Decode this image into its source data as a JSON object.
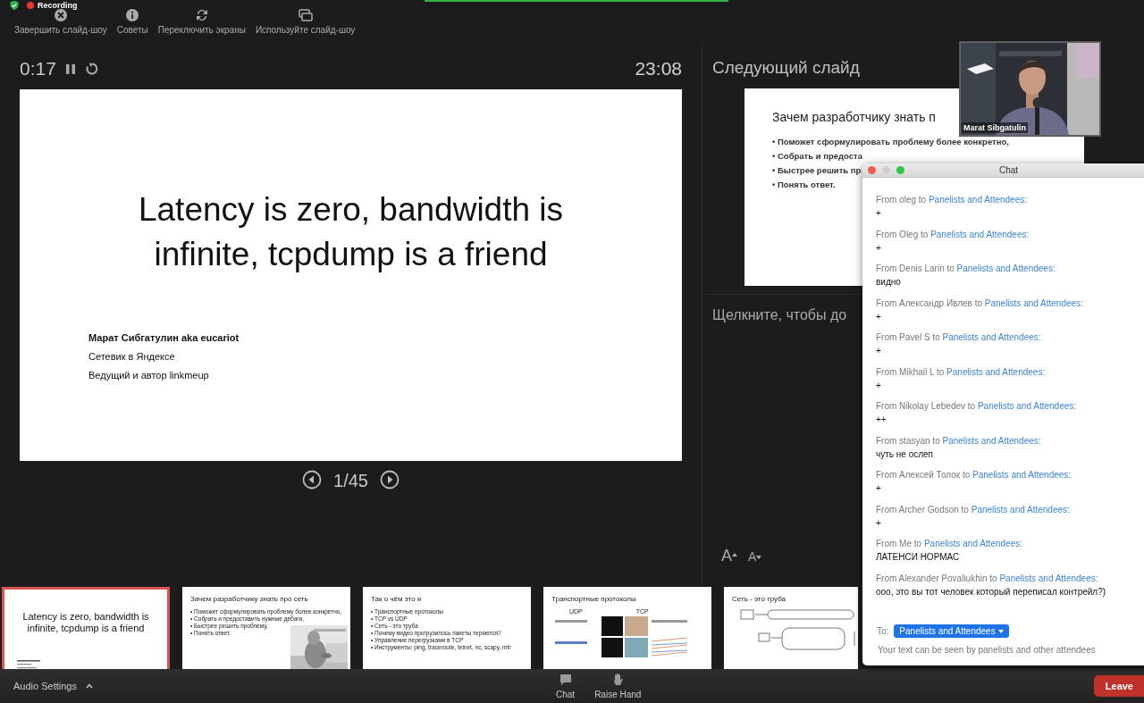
{
  "status": {
    "recording_label": "Recording"
  },
  "toolbar": [
    {
      "kind": "end",
      "label": "Завершить слайд-шоу"
    },
    {
      "kind": "tips",
      "label": "Советы"
    },
    {
      "kind": "swap",
      "label": "Переключить экраны"
    },
    {
      "kind": "display",
      "label": "Используйте слайд-шоу"
    }
  ],
  "presenter": {
    "elapsed": "0:17",
    "clock": "23:08",
    "slide_counter": "1/45",
    "current_slide": {
      "title": "Latency is zero, bandwidth is infinite, tcpdump is a friend",
      "author": "Марат Сибгатулин aka eucariot",
      "lines": [
        "Сетевик в Яндексе",
        "Ведущий и автор linkmeup"
      ]
    }
  },
  "next": {
    "heading": "Следующий слайд",
    "slide": {
      "title": "Зачем разработчику знать п",
      "bullets": [
        "• Поможет сформулировать проблему более конкретно,",
        "• Собрать и предоста",
        "• Быстрее решить пр",
        "• Понять ответ."
      ]
    },
    "notes_prompt": "Щелкните, чтобы до",
    "font_controls": [
      {
        "kind": "increase",
        "glyph": "A"
      },
      {
        "kind": "decrease",
        "glyph": "A"
      }
    ]
  },
  "thumbnails": [
    {
      "kind": "title",
      "selected": true,
      "title": "Latency is zero, bandwidth is infinite, tcpdump is a friend"
    },
    {
      "kind": "bullets",
      "selected": false,
      "title": "Зачем разработчику знать про сеть",
      "bullets": [
        "• Поможет сформулировать проблему более конкретно,",
        "• Собрать и предоставить нужные дебаги,",
        "• Быстрее решить проблему,",
        "• Понять ответ."
      ],
      "photo": true
    },
    {
      "kind": "bullets",
      "selected": false,
      "title": "Так о чём это я",
      "bullets": [
        "• Транспортные протоколы",
        "• TCP vs UDP",
        "• Сеть - это труба",
        "• Почему видео прогрузилось пакеты теряются?",
        "• Управление перегрузками в TCP",
        "• Инструменты: ping, traceroute, telnet, nc, scapy, mtr"
      ],
      "photo": false
    },
    {
      "kind": "protocols",
      "selected": false,
      "title": "Транспортные протоколы",
      "labels": [
        "UDP",
        "TCP"
      ]
    },
    {
      "kind": "pipe",
      "selected": false,
      "title": "Сеть - это труба"
    }
  ],
  "video": {
    "name": "Marat Sibgatulin"
  },
  "chat": {
    "title": "Chat",
    "messages": [
      {
        "from": "From oleg to",
        "recipient": "Panelists and Attendees:",
        "text": "+"
      },
      {
        "from": "From Oleg to",
        "recipient": "Panelists and Attendees:",
        "text": "+"
      },
      {
        "from": "From Denis Larin to",
        "recipient": "Panelists and Attendees:",
        "text": "видно"
      },
      {
        "from": "From Александр Ивлев to",
        "recipient": "Panelists and Attendees:",
        "text": "+"
      },
      {
        "from": "From Pavel S to",
        "recipient": "Panelists and Attendees:",
        "text": "+"
      },
      {
        "from": "From Mikhail L to",
        "recipient": "Panelists and Attendees:",
        "text": "+"
      },
      {
        "from": "From Nikolay Lebedev to",
        "recipient": "Panelists and Attendees:",
        "text": "++"
      },
      {
        "from": "From stasyan to",
        "recipient": "Panelists and Attendees:",
        "text": "чуть не ослеп"
      },
      {
        "from": "From Алексей Толок to",
        "recipient": "Panelists and Attendees:",
        "text": "+"
      },
      {
        "from": "From Archer Godson to",
        "recipient": "Panelists and Attendees:",
        "text": "+"
      },
      {
        "from": "From Me to",
        "recipient": "Panelists and Attendees:",
        "text": "ЛАТЕНСИ НОРМАС"
      },
      {
        "from": "From Alexander Povaliukhin to",
        "recipient": "Panelists and Attendees:",
        "text": "ооо, это вы тот человек который переписал контрейл?)"
      }
    ],
    "to_label": "To:",
    "recipient_choice": "Panelists and Attendees",
    "hint": "Your text can be seen by panelists and other attendees"
  },
  "bottom": {
    "audio": "Audio Settings",
    "buttons": [
      {
        "kind": "chat",
        "label": "Chat"
      },
      {
        "kind": "hand",
        "label": "Raise Hand"
      }
    ],
    "leave": "Leave"
  }
}
